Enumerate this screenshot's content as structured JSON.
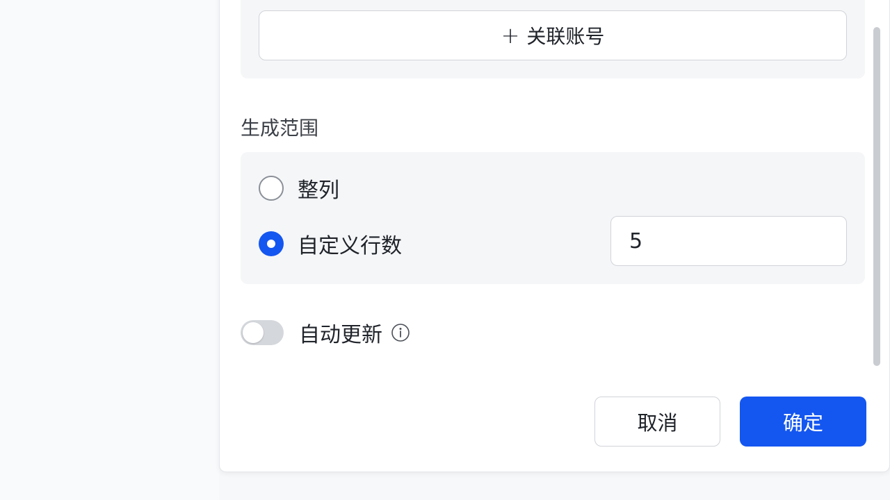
{
  "account": {
    "link_label": "关联账号"
  },
  "range": {
    "title": "生成范围",
    "options": [
      {
        "label": "整列",
        "checked": false
      },
      {
        "label": "自定义行数",
        "checked": true
      }
    ],
    "row_count": "5"
  },
  "auto_update": {
    "label": "自动更新",
    "enabled": false
  },
  "footer": {
    "cancel_label": "取消",
    "confirm_label": "确定"
  },
  "colors": {
    "primary": "#1456f0",
    "panel_bg": "#f5f6f8",
    "border": "#d0d3d8"
  },
  "icons": {
    "link_account": "plus-icon",
    "info": "info-circle-icon",
    "stepper_up": "chevron-up-icon",
    "stepper_down": "chevron-down-icon"
  }
}
